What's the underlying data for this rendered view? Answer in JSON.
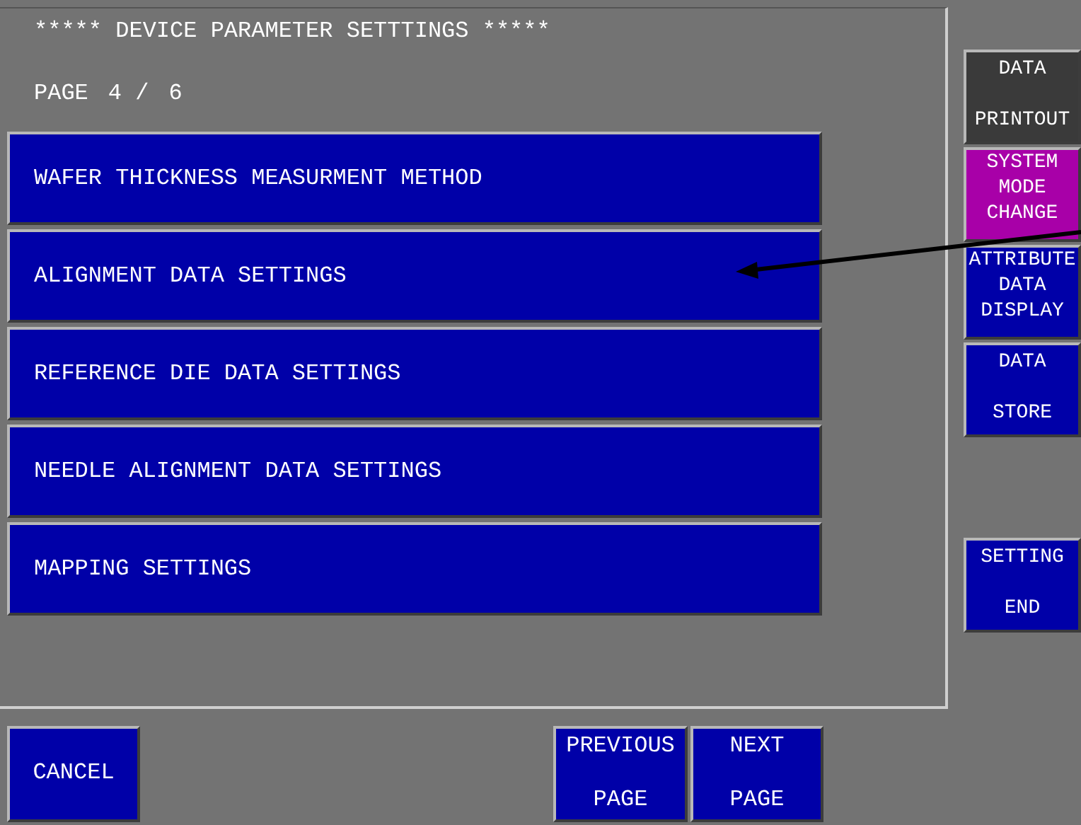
{
  "header": {
    "title": "***** DEVICE PARAMETER SETTTINGS *****",
    "page_label": "PAGE",
    "page_current": "4 /",
    "page_total": "6"
  },
  "menu_items": [
    "WAFER THICKNESS MEASURMENT METHOD",
    "ALIGNMENT DATA SETTINGS",
    "REFERENCE DIE DATA SETTINGS",
    "NEEDLE ALIGNMENT DATA SETTINGS",
    "MAPPING SETTINGS"
  ],
  "side_buttons": [
    {
      "lines": [
        "DATA",
        "PRINTOUT"
      ],
      "color": "#3a3a3a",
      "kind": "split"
    },
    {
      "lines": [
        "SYSTEM",
        "MODE",
        "CHANGE"
      ],
      "color": "#a800a8",
      "kind": "stacked"
    },
    {
      "lines": [
        "ATTRIBUTE",
        "DATA",
        "DISPLAY"
      ],
      "color": "#0000a8",
      "kind": "stacked"
    },
    {
      "lines": [
        "DATA",
        "STORE"
      ],
      "color": "#0000a8",
      "kind": "split"
    },
    {
      "lines": [
        "SETTING",
        "END"
      ],
      "color": "#0000a8",
      "kind": "split_spaced"
    }
  ],
  "bottom_buttons": [
    {
      "lines": [
        "CANCEL"
      ]
    },
    {
      "lines": [
        "PREVIOUS",
        "PAGE"
      ]
    },
    {
      "lines": [
        "NEXT",
        "PAGE"
      ]
    }
  ]
}
